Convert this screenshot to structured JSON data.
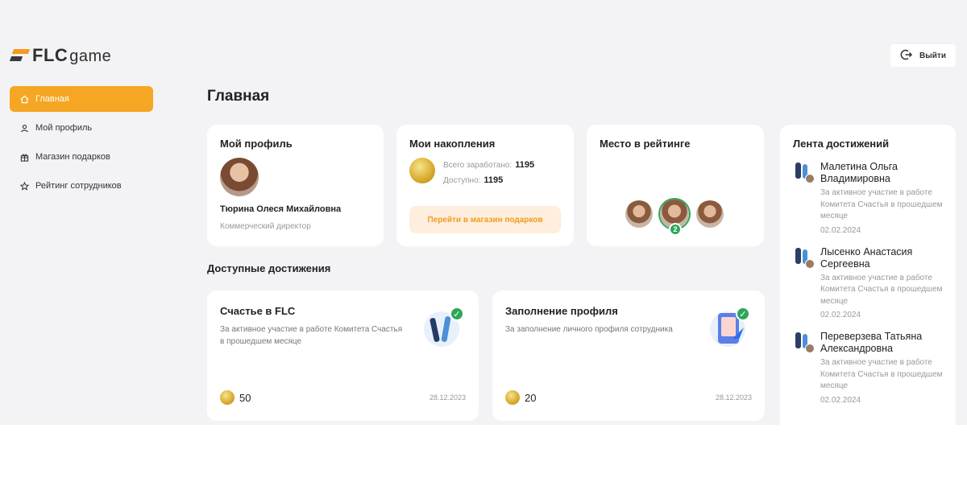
{
  "brand": {
    "mark": "FLC",
    "word": "game"
  },
  "header": {
    "logout_label": "Выйти"
  },
  "sidebar": {
    "items": [
      {
        "label": "Главная",
        "icon": "home-icon",
        "active": true
      },
      {
        "label": "Мой профиль",
        "icon": "user-icon",
        "active": false
      },
      {
        "label": "Магазин подарков",
        "icon": "gift-icon",
        "active": false
      },
      {
        "label": "Рейтинг сотрудников",
        "icon": "star-icon",
        "active": false
      }
    ]
  },
  "page": {
    "title": "Главная"
  },
  "profile": {
    "title": "Мой профиль",
    "name": "Тюрина Олеся Михайловна",
    "role": "Коммерческий директор"
  },
  "savings": {
    "title": "Мои накопления",
    "earned_label": "Всего заработано:",
    "earned_value": "1195",
    "available_label": "Доступно:",
    "available_value": "1195",
    "shop_button": "Перейти в магазин подарков"
  },
  "rating": {
    "title": "Место в рейтинге",
    "place": "2"
  },
  "achievements": {
    "title": "Доступные достижения",
    "items": [
      {
        "title": "Счастье в FLC",
        "desc": "За активное участие в работе Комитета Счастья в прошедшем месяце",
        "points": "50",
        "date": "28.12.2023"
      },
      {
        "title": "Заполнение профиля",
        "desc": "За заполнение личного профиля сотрудника",
        "points": "20",
        "date": "28.12.2023"
      }
    ]
  },
  "feed": {
    "title": "Лента достижений",
    "items": [
      {
        "name": "Малетина Ольга Владимировна",
        "desc": "За активное участие в работе Комитета Счастья в прошедшем месяце",
        "date": "02.02.2024"
      },
      {
        "name": "Лысенко Анастасия Сергеевна",
        "desc": "За активное участие в работе Комитета Счастья в прошедшем месяце",
        "date": "02.02.2024"
      },
      {
        "name": "Переверзева Татьяна Александровна",
        "desc": "За активное участие в работе Комитета Счастья в прошедшем месяце",
        "date": "02.02.2024"
      }
    ]
  },
  "colors": {
    "accent": "#f5a623",
    "success": "#2fa65a",
    "background": "#f3f3f5"
  }
}
